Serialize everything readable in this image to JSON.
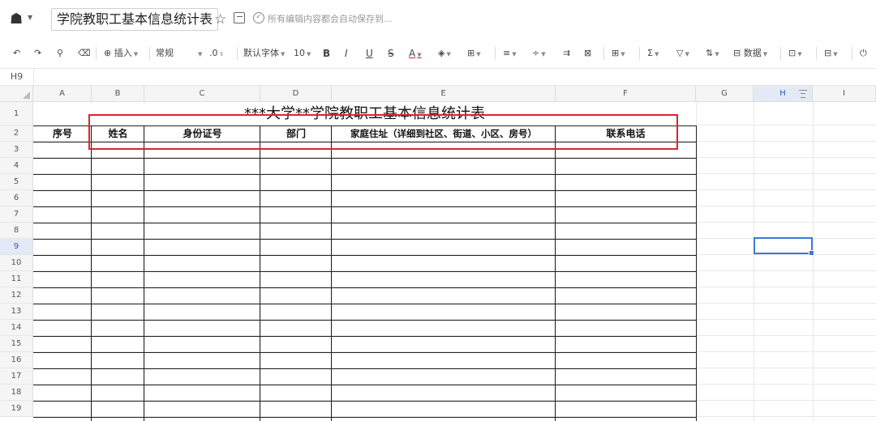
{
  "titlebar": {
    "doc_title": "学院教职工基本信息统计表",
    "save_status": "所有编辑内容都会自动保存到..."
  },
  "toolbar": {
    "insert": "插入",
    "format": "常规",
    "decimal": ".0",
    "font": "默认字体",
    "font_size": "10",
    "bold": "B",
    "italic": "I",
    "underline": "U",
    "strike": "S",
    "font_color": "A",
    "data": "数据"
  },
  "formulabar": {
    "cell_ref": "H9"
  },
  "columns": [
    "A",
    "B",
    "C",
    "D",
    "E",
    "F",
    "G",
    "H",
    "I"
  ],
  "rows": [
    "1",
    "2",
    "3",
    "4",
    "5",
    "6",
    "7",
    "8",
    "9",
    "10",
    "11",
    "12",
    "13",
    "14",
    "15",
    "16",
    "17",
    "18",
    "19"
  ],
  "table": {
    "title": "***大学**学院教职工基本信息统计表",
    "headers": [
      "序号",
      "姓名",
      "身份证号",
      "部门",
      "家庭住址（详细到社区、街道、小区、房号）",
      "联系电话"
    ]
  },
  "colors": {
    "highlight": "#d9252f",
    "selection": "#3a7bd5"
  }
}
